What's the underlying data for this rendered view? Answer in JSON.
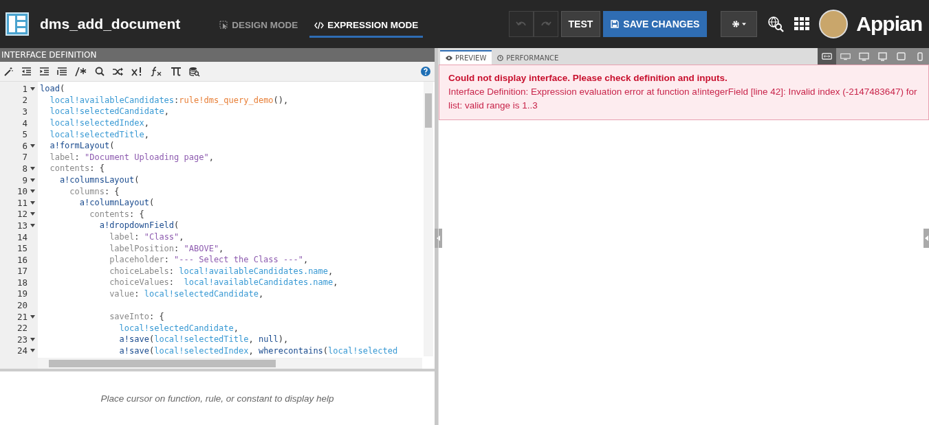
{
  "header": {
    "title": "dms_add_document",
    "modes": [
      {
        "label": "DESIGN MODE",
        "kind": "design",
        "selected": false
      },
      {
        "label": "EXPRESSION MODE",
        "kind": "expression",
        "selected": true
      }
    ],
    "undo_disabled": true,
    "redo_disabled": true,
    "test_label": "TEST",
    "save_label": "SAVE CHANGES",
    "brand": "Appian"
  },
  "editor": {
    "title": "INTERFACE DEFINITION",
    "lines": [
      {
        "number": "1",
        "foldable": true,
        "tokens": [
          {
            "kind": "fn",
            "text": "load"
          },
          {
            "kind": "punct",
            "text": "("
          }
        ]
      },
      {
        "number": "2",
        "foldable": false,
        "tokens": [
          {
            "kind": "var",
            "text": "  local!availableCandidates"
          },
          {
            "kind": "punct",
            "text": ":"
          },
          {
            "kind": "rule",
            "text": "rule!dms_query_demo"
          },
          {
            "kind": "punct",
            "text": "(),"
          }
        ]
      },
      {
        "number": "3",
        "foldable": false,
        "tokens": [
          {
            "kind": "var",
            "text": "  local!selectedCandidate"
          },
          {
            "kind": "punct",
            "text": ","
          }
        ]
      },
      {
        "number": "4",
        "foldable": false,
        "tokens": [
          {
            "kind": "var",
            "text": "  local!selectedIndex"
          },
          {
            "kind": "punct",
            "text": ","
          }
        ]
      },
      {
        "number": "5",
        "foldable": false,
        "tokens": [
          {
            "kind": "var",
            "text": "  local!selectedTitle"
          },
          {
            "kind": "punct",
            "text": ","
          }
        ]
      },
      {
        "number": "6",
        "foldable": true,
        "tokens": [
          {
            "kind": "fn",
            "text": "  a!formLayout"
          },
          {
            "kind": "punct",
            "text": "("
          }
        ]
      },
      {
        "number": "7",
        "foldable": false,
        "tokens": [
          {
            "kind": "key",
            "text": "  label"
          },
          {
            "kind": "punct",
            "text": ": "
          },
          {
            "kind": "str",
            "text": "\"Document Uploading page\""
          },
          {
            "kind": "punct",
            "text": ","
          }
        ]
      },
      {
        "number": "8",
        "foldable": true,
        "tokens": [
          {
            "kind": "key",
            "text": "  contents"
          },
          {
            "kind": "punct",
            "text": ": {"
          }
        ]
      },
      {
        "number": "9",
        "foldable": true,
        "tokens": [
          {
            "kind": "fn",
            "text": "    a!columnsLayout"
          },
          {
            "kind": "punct",
            "text": "("
          }
        ]
      },
      {
        "number": "10",
        "foldable": true,
        "tokens": [
          {
            "kind": "key",
            "text": "      columns"
          },
          {
            "kind": "punct",
            "text": ": {"
          }
        ]
      },
      {
        "number": "11",
        "foldable": true,
        "tokens": [
          {
            "kind": "fn",
            "text": "        a!columnLayout"
          },
          {
            "kind": "punct",
            "text": "("
          }
        ]
      },
      {
        "number": "12",
        "foldable": true,
        "tokens": [
          {
            "kind": "key",
            "text": "          contents"
          },
          {
            "kind": "punct",
            "text": ": {"
          }
        ]
      },
      {
        "number": "13",
        "foldable": true,
        "tokens": [
          {
            "kind": "fn",
            "text": "            a!dropdownField"
          },
          {
            "kind": "punct",
            "text": "("
          }
        ]
      },
      {
        "number": "14",
        "foldable": false,
        "tokens": [
          {
            "kind": "key",
            "text": "              label"
          },
          {
            "kind": "punct",
            "text": ": "
          },
          {
            "kind": "str",
            "text": "\"Class\""
          },
          {
            "kind": "punct",
            "text": ","
          }
        ]
      },
      {
        "number": "15",
        "foldable": false,
        "tokens": [
          {
            "kind": "key",
            "text": "              labelPosition"
          },
          {
            "kind": "punct",
            "text": ": "
          },
          {
            "kind": "str",
            "text": "\"ABOVE\""
          },
          {
            "kind": "punct",
            "text": ","
          }
        ]
      },
      {
        "number": "16",
        "foldable": false,
        "tokens": [
          {
            "kind": "key",
            "text": "              placeholder"
          },
          {
            "kind": "punct",
            "text": ": "
          },
          {
            "kind": "str",
            "text": "\"--- Select the Class ---\""
          },
          {
            "kind": "punct",
            "text": ","
          }
        ]
      },
      {
        "number": "17",
        "foldable": false,
        "tokens": [
          {
            "kind": "key",
            "text": "              choiceLabels"
          },
          {
            "kind": "punct",
            "text": ": "
          },
          {
            "kind": "var",
            "text": "local!availableCandidates.name"
          },
          {
            "kind": "punct",
            "text": ","
          }
        ]
      },
      {
        "number": "18",
        "foldable": false,
        "tokens": [
          {
            "kind": "key",
            "text": "              choiceValues"
          },
          {
            "kind": "punct",
            "text": ":  "
          },
          {
            "kind": "var",
            "text": "local!availableCandidates.name"
          },
          {
            "kind": "punct",
            "text": ","
          }
        ]
      },
      {
        "number": "19",
        "foldable": false,
        "tokens": [
          {
            "kind": "key",
            "text": "              value"
          },
          {
            "kind": "punct",
            "text": ": "
          },
          {
            "kind": "var",
            "text": "local!selectedCandidate"
          },
          {
            "kind": "punct",
            "text": ","
          }
        ]
      },
      {
        "number": "20",
        "foldable": false
      },
      {
        "number": "21",
        "foldable": true,
        "tokens": [
          {
            "kind": "key",
            "text": "              saveInto"
          },
          {
            "kind": "punct",
            "text": ": {"
          }
        ]
      },
      {
        "number": "22",
        "foldable": false,
        "tokens": [
          {
            "kind": "var",
            "text": "                local!selectedCandidate"
          },
          {
            "kind": "punct",
            "text": ","
          }
        ]
      },
      {
        "number": "23",
        "foldable": true,
        "tokens": [
          {
            "kind": "fn",
            "text": "                a!save"
          },
          {
            "kind": "punct",
            "text": "("
          },
          {
            "kind": "var",
            "text": "local!selectedTitle"
          },
          {
            "kind": "punct",
            "text": ", "
          },
          {
            "kind": "fn",
            "text": "null"
          },
          {
            "kind": "punct",
            "text": "),"
          }
        ]
      },
      {
        "number": "24",
        "foldable": true,
        "tokens": [
          {
            "kind": "fn",
            "text": "                a!save"
          },
          {
            "kind": "punct",
            "text": "("
          },
          {
            "kind": "var",
            "text": "local!selectedIndex"
          },
          {
            "kind": "punct",
            "text": ", "
          },
          {
            "kind": "fn",
            "text": "wherecontains"
          },
          {
            "kind": "punct",
            "text": "("
          },
          {
            "kind": "var",
            "text": "local!selected"
          }
        ]
      }
    ],
    "help": "Place cursor on function, rule, or constant to display help"
  },
  "preview": {
    "tabs": [
      {
        "label": "PREVIEW",
        "kind": "preview",
        "selected": true
      },
      {
        "label": "PERFORMANCE",
        "kind": "performance",
        "selected": false
      }
    ],
    "devices": [
      {
        "kind": "fit",
        "selected": true
      },
      {
        "kind": "wide",
        "selected": false
      },
      {
        "kind": "desktop",
        "selected": false
      },
      {
        "kind": "monitor",
        "selected": false
      },
      {
        "kind": "tablet",
        "selected": false
      },
      {
        "kind": "phone",
        "selected": false
      }
    ],
    "error_title": "Could not display interface. Please check definition and inputs.",
    "error_message": "Interface Definition: Expression evaluation error at function a!integerField [line 42]: Invalid index (-2147483647) for list: valid range is 1..3"
  }
}
